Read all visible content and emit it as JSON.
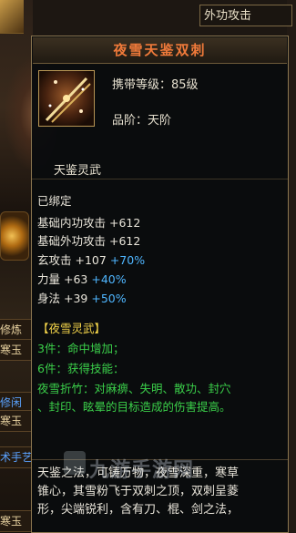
{
  "side_panel": {
    "outer_attack_label": "外功攻击",
    "fragments": [
      "修炼",
      "寒玉",
      "修闲",
      "寒玉",
      "术手艺",
      "寒玉"
    ]
  },
  "tooltip": {
    "title": "夜雪天鉴双刺",
    "carry_level_label": "携带等级：85级",
    "grade_label": "品阶：天阶",
    "spirit_weapon_name": "天鉴灵武",
    "bound_status": "已绑定",
    "stats": [
      {
        "name": "基础内功攻击",
        "value": "+612",
        "bonus": ""
      },
      {
        "name": "基础外功攻击",
        "value": "+612",
        "bonus": ""
      },
      {
        "name": "玄攻击",
        "value": "+107",
        "bonus": "+70%"
      },
      {
        "name": "力量",
        "value": "+63",
        "bonus": "+40%"
      },
      {
        "name": "身法",
        "value": "+39",
        "bonus": "+50%"
      }
    ],
    "set": {
      "name": "【夜雪灵武】",
      "piece3": "3件：命中增加；",
      "piece6": "6件：获得技能：",
      "skill_line1": "夜雪折竹：对麻痹、失明、散功、封穴",
      "skill_line2": "、封印、眩晕的目标造成的伤害提高。"
    },
    "description_lines": [
      "天鉴之法，可铸万物，夜雪深重，寒草",
      "锥心，其雪粉飞于双刺之顶，双刺呈菱",
      "形，尖端锐利，含有刀、棍、剑之法，"
    ]
  },
  "watermark_text": "九游手游网",
  "colors": {
    "title": "#f07a3a",
    "green": "#3bd04a",
    "cyan": "#4fb6ff",
    "yellow": "#f4d54a",
    "border": "#8b7650"
  }
}
